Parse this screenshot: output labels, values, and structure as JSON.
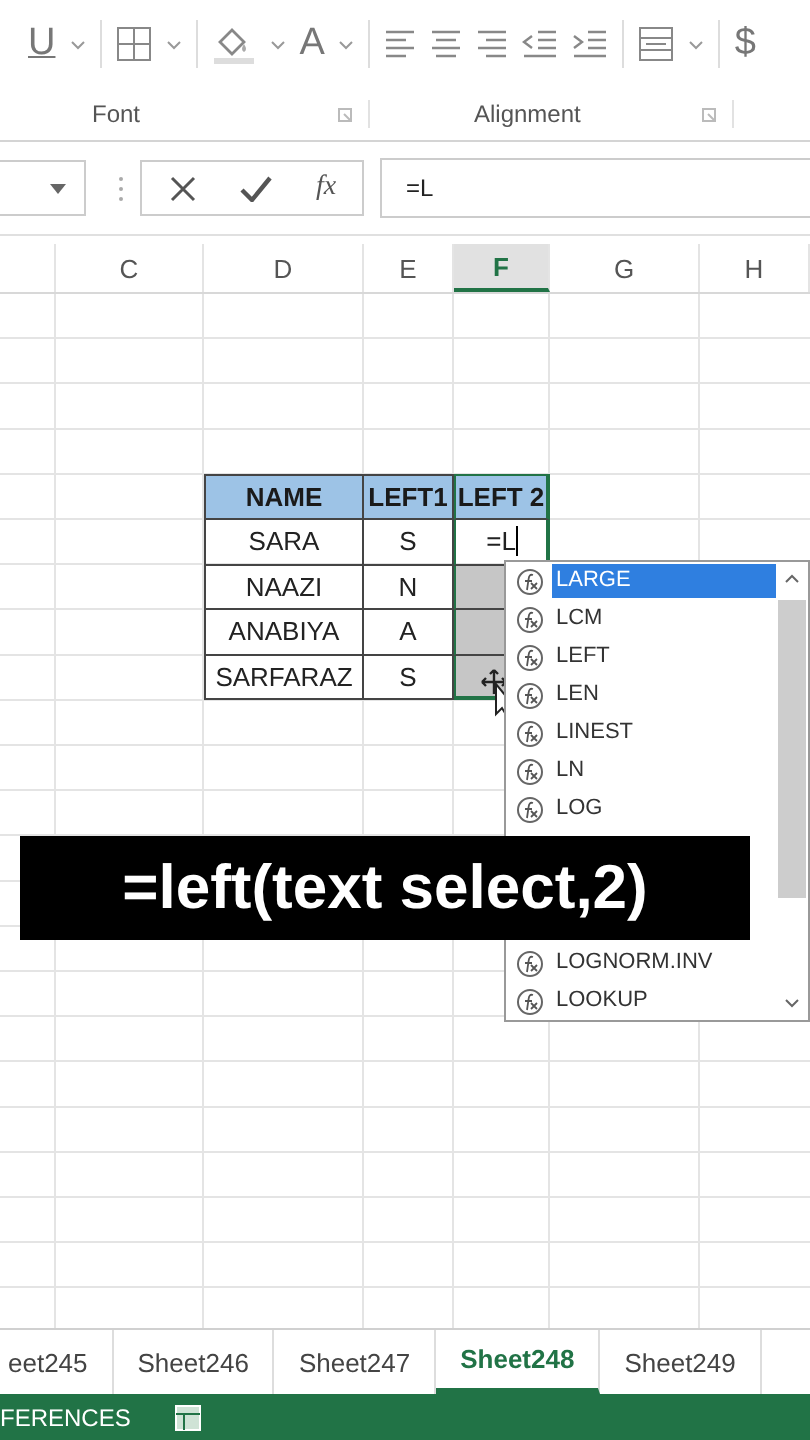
{
  "ribbon": {
    "underline": "U",
    "font_color": "A",
    "currency": "$",
    "groups": [
      {
        "label": "Font"
      },
      {
        "label": "Alignment"
      }
    ]
  },
  "formula_bar": {
    "insert_function": "fx",
    "formula": "=L"
  },
  "columns": [
    {
      "label": "C",
      "selected": false
    },
    {
      "label": "D",
      "selected": false
    },
    {
      "label": "E",
      "selected": false
    },
    {
      "label": "F",
      "selected": true
    },
    {
      "label": "G",
      "selected": false
    },
    {
      "label": "H",
      "selected": false
    }
  ],
  "table": {
    "headers": [
      "NAME",
      "LEFT1",
      "LEFT 2"
    ],
    "rows": [
      {
        "name": "SARA",
        "left1": "S",
        "left2": "=L",
        "editing": true,
        "highlighted": false
      },
      {
        "name": "NAAZI",
        "left1": "N",
        "left2": "",
        "editing": false,
        "highlighted": true
      },
      {
        "name": "ANABIYA",
        "left1": "A",
        "left2": "",
        "editing": false,
        "highlighted": true
      },
      {
        "name": "SARFARAZ",
        "left1": "S",
        "left2": "",
        "editing": false,
        "highlighted": true
      }
    ]
  },
  "autocomplete": {
    "items": [
      {
        "label": "LARGE",
        "selected": true
      },
      {
        "label": "LCM",
        "selected": false
      },
      {
        "label": "LEFT",
        "selected": false
      },
      {
        "label": "LEN",
        "selected": false
      },
      {
        "label": "LINEST",
        "selected": false
      },
      {
        "label": "LN",
        "selected": false
      },
      {
        "label": "LOG",
        "selected": false
      }
    ],
    "items_below_caption": [
      {
        "label": "LOGNORM.INV",
        "selected": false
      },
      {
        "label": "LOOKUP",
        "selected": false
      }
    ]
  },
  "caption": "=left(text select,2)",
  "sheet_tabs": [
    {
      "label": "eet245",
      "selected": false
    },
    {
      "label": "Sheet246",
      "selected": false
    },
    {
      "label": "Sheet247",
      "selected": false
    },
    {
      "label": "Sheet248",
      "selected": true
    },
    {
      "label": "Sheet249",
      "selected": false
    }
  ],
  "status_bar": {
    "mode": "FERENCES"
  }
}
